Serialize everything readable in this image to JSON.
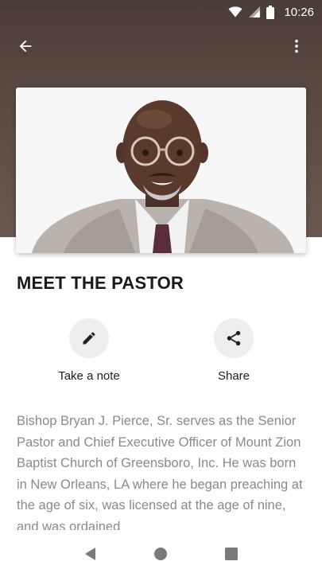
{
  "status_bar": {
    "time": "10:26",
    "icons": [
      "wifi-icon",
      "cellular-signal-icon",
      "battery-icon"
    ]
  },
  "app_bar": {
    "back_icon": "arrow-back-icon",
    "menu_icon": "more-vert-icon"
  },
  "colors": {
    "header_bg": "#5b4a44",
    "action_circle": "#eeeeee",
    "body_text": "#8a8a8a",
    "title_text": "#1a1a1a"
  },
  "page": {
    "title": "MEET THE PASTOR"
  },
  "actions": [
    {
      "label": "Take a note",
      "icon": "pencil-icon"
    },
    {
      "label": "Share",
      "icon": "share-icon"
    }
  ],
  "bio": {
    "text": "Bishop Bryan J. Pierce, Sr. serves as the Senior Pastor and Chief Executive Officer of Mount Zion Baptist Church of Greensboro, Inc. He was born in New Orleans, LA where he began preaching at the age of six, was licensed at the age of nine, and was ordained"
  },
  "nav_bar": {
    "icons": [
      "back-triangle-icon",
      "home-circle-icon",
      "recents-square-icon"
    ]
  }
}
